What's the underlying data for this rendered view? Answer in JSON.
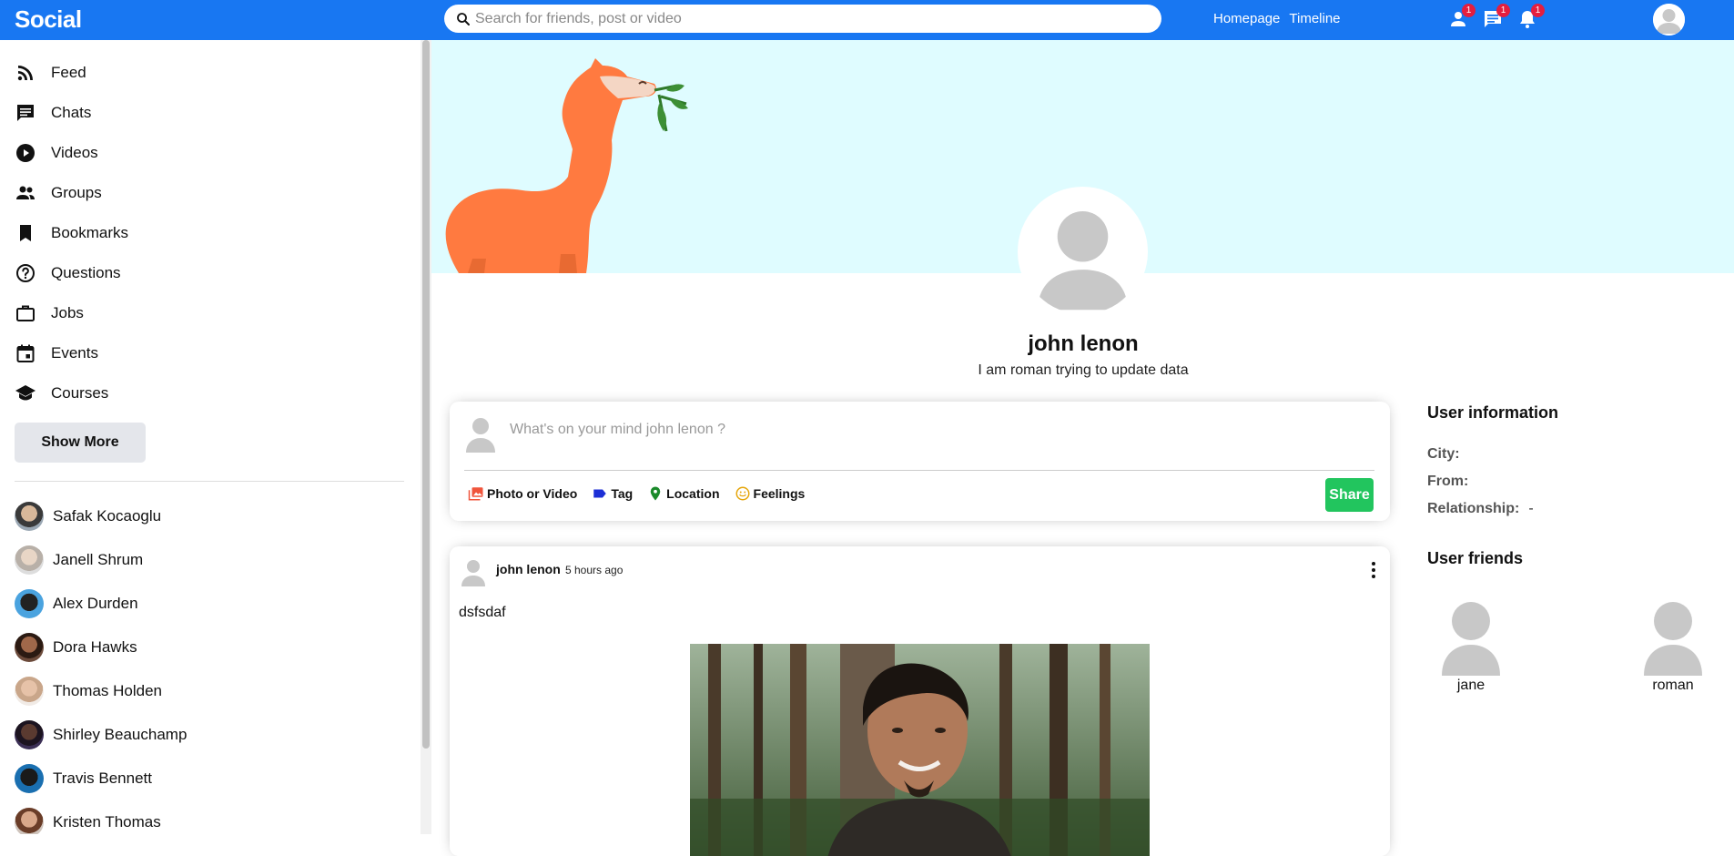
{
  "topbar": {
    "logo": "Social",
    "search_placeholder": "Search for friends, post or video",
    "links": [
      "Homepage",
      "Timeline"
    ],
    "badges": {
      "friends": "1",
      "messages": "1",
      "notifications": "1"
    },
    "color": "#1877f2"
  },
  "sidebar": {
    "items": [
      {
        "label": "Feed",
        "icon": "rss-feed-icon"
      },
      {
        "label": "Chats",
        "icon": "chat-icon"
      },
      {
        "label": "Videos",
        "icon": "play-circle-icon"
      },
      {
        "label": "Groups",
        "icon": "group-icon"
      },
      {
        "label": "Bookmarks",
        "icon": "bookmark-icon"
      },
      {
        "label": "Questions",
        "icon": "help-outline-icon"
      },
      {
        "label": "Jobs",
        "icon": "work-outline-icon"
      },
      {
        "label": "Events",
        "icon": "event-icon"
      },
      {
        "label": "Courses",
        "icon": "school-icon"
      }
    ],
    "show_more_label": "Show More",
    "friends": [
      "Safak Kocaoglu",
      "Janell Shrum",
      "Alex Durden",
      "Dora Hawks",
      "Thomas Holden",
      "Shirley Beauchamp",
      "Travis Bennett",
      "Kristen Thomas"
    ]
  },
  "profile": {
    "name": "john lenon",
    "description": "I am roman trying to update data",
    "cover_color": "#dffcff"
  },
  "share": {
    "placeholder": "What's on your mind john lenon ?",
    "options": {
      "photo_video": "Photo or Video",
      "tag": "Tag",
      "location": "Location",
      "feelings": "Feelings"
    },
    "button_label": "Share",
    "button_color": "#22c55e"
  },
  "post": {
    "username": "john lenon",
    "time": "5 hours ago",
    "text": "dsfsdaf"
  },
  "rightbar": {
    "info_title": "User information",
    "info": [
      {
        "key": "City:",
        "value": ""
      },
      {
        "key": "From:",
        "value": ""
      },
      {
        "key": "Relationship:",
        "value": "-"
      }
    ],
    "friends_title": "User friends",
    "friends": [
      "jane",
      "roman"
    ]
  }
}
